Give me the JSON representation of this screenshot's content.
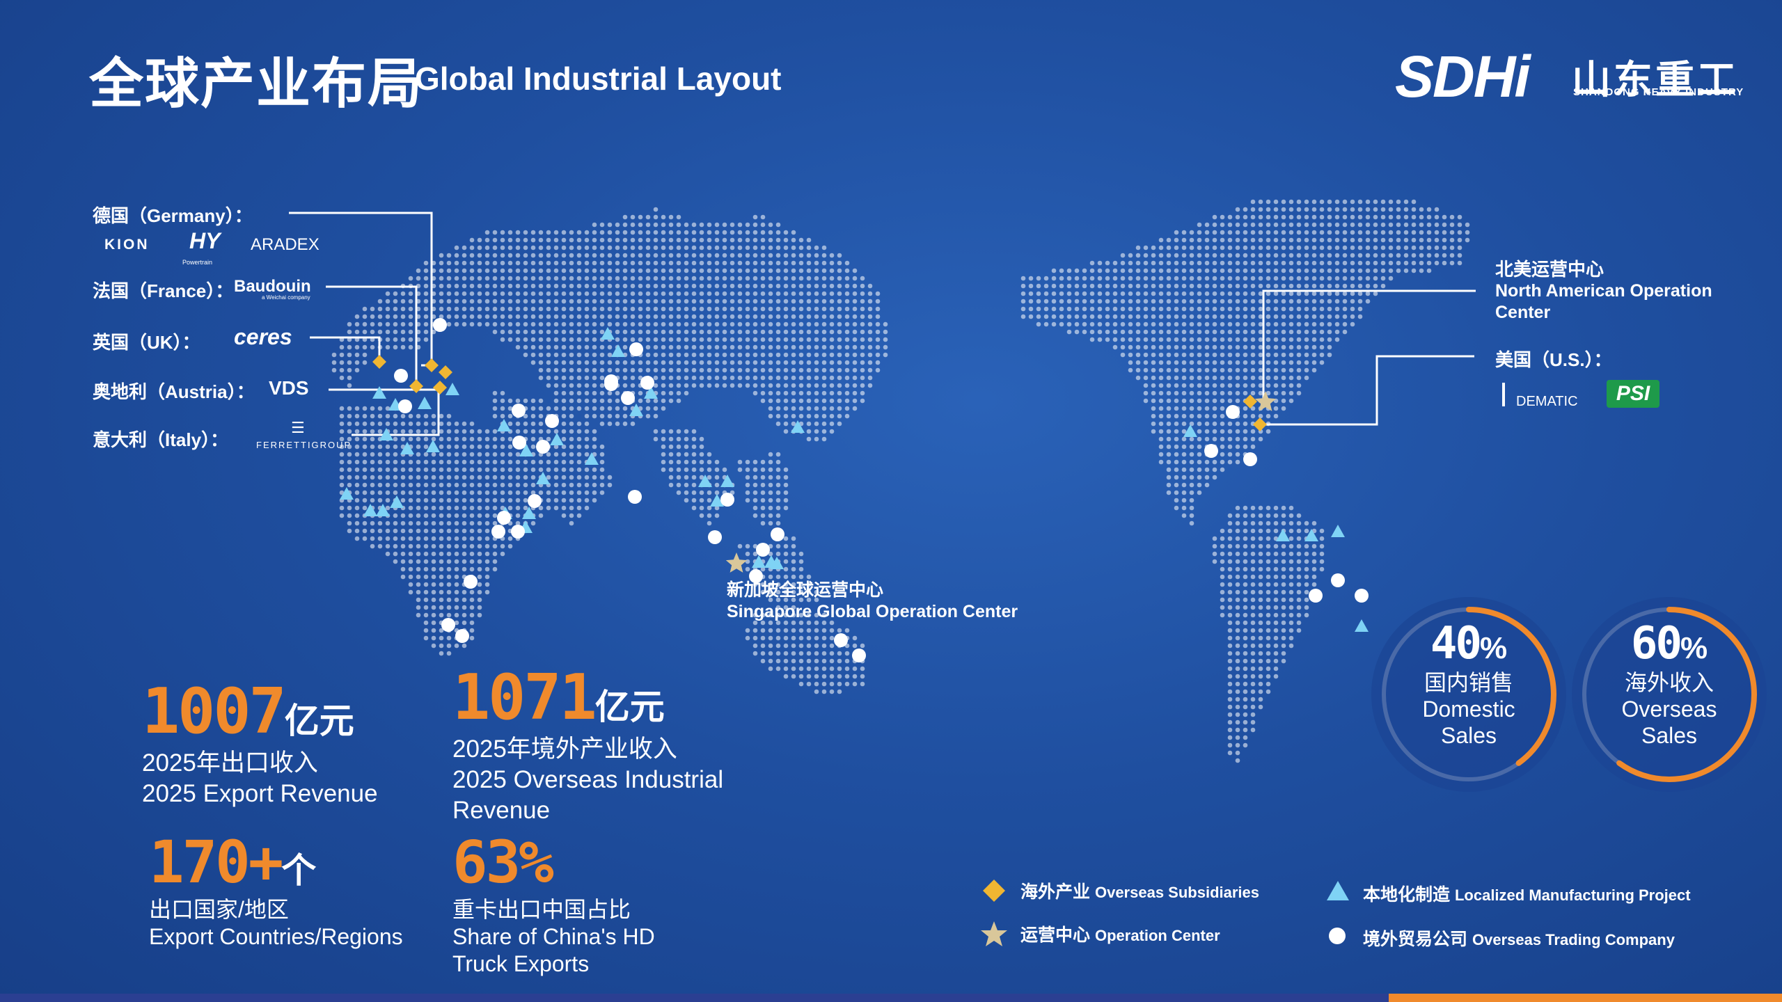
{
  "header": {
    "title_zh": "全球产业布局",
    "title_en": "Global Industrial Layout"
  },
  "logo": {
    "brand": "SDHi",
    "name_zh": "山东重工",
    "name_en": "SHANDONG HEAVY INDUSTRY"
  },
  "europe": {
    "germany": {
      "label": "德国（Germany）：",
      "brands": [
        "KION",
        "HY",
        "ARADEX"
      ],
      "hy_sub": "Powertrain"
    },
    "france": {
      "label": "法国（France）：",
      "brand": "Baudouin",
      "brand_sub": "a Weichai company"
    },
    "uk": {
      "label": "英国（UK）：",
      "brand": "ceres"
    },
    "austria": {
      "label": "奥地利（Austria）：",
      "brand": "VDS"
    },
    "italy": {
      "label": "意大利（Italy）：",
      "brand": "FERRETTIGROUP"
    }
  },
  "north_america": {
    "center_zh": "北美运营中心",
    "center_en_1": "North American Operation",
    "center_en_2": "Center",
    "us_label": "美国（U.S.）：",
    "us_brands": [
      "DEMATIC",
      "PSI"
    ]
  },
  "singapore": {
    "zh": "新加坡全球运营中心",
    "en": "Singapore Global Operation Center"
  },
  "stats": [
    {
      "value": "1007",
      "unit": "亿元",
      "zh": "2025年出口收入",
      "en": "2025 Export Revenue"
    },
    {
      "value": "1071",
      "unit": "亿元",
      "zh": "2025年境外产业收入",
      "en_1": "2025 Overseas Industrial",
      "en_2": "Revenue"
    },
    {
      "value": "170+",
      "unit": "个",
      "zh": "出口国家/地区",
      "en": "Export Countries/Regions"
    },
    {
      "value": "63%",
      "zh": "重卡出口中国占比",
      "en_1": "Share of China's HD",
      "en_2": "Truck Exports"
    }
  ],
  "rings": [
    {
      "value": 40,
      "pct_num": "40",
      "pct_sign": "%",
      "zh": "国内销售",
      "en_1": "Domestic",
      "en_2": "Sales"
    },
    {
      "value": 60,
      "pct_num": "60",
      "pct_sign": "%",
      "zh": "海外收入",
      "en_1": "Overseas",
      "en_2": "Sales"
    }
  ],
  "legend": {
    "subsidiaries_zh": "海外产业",
    "subsidiaries_en": "Overseas Subsidiaries",
    "op_center_zh": "运营中心",
    "op_center_en": "Operation Center",
    "manufacturing_zh": "本地化制造",
    "manufacturing_en": "Localized Manufacturing Project",
    "trading_zh": "境外贸易公司",
    "trading_en": "Overseas Trading Company"
  },
  "colors": {
    "accent": "#f08a2c",
    "diamond": "#f0b632",
    "star": "#d9c79a",
    "triangle": "#7fd3f5",
    "background": "#1f4fa0"
  }
}
